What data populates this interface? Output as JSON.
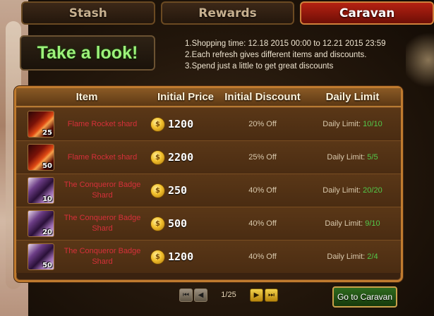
{
  "tabs": [
    {
      "label": "Stash",
      "active": false
    },
    {
      "label": "Rewards",
      "active": false
    },
    {
      "label": "Caravan",
      "active": true
    }
  ],
  "banner": {
    "title": "Take a look!"
  },
  "rules": [
    "1.Shopping time: 12.18 2015 00:00 to 12.21 2015 23:59",
    "2.Each refresh gives different items and discounts.",
    "3.Spend just a little to get great discounts"
  ],
  "table": {
    "headers": [
      "Item",
      "Initial Price",
      "Initial Discount",
      "Daily Limit"
    ],
    "rows": [
      {
        "icon": "flame-rocket-shard-icon",
        "qty": "25",
        "name": "Flame Rocket shard",
        "price": "1200",
        "discount": "20% Off",
        "limit_label": "Daily Limit:",
        "limit_value": "10/10"
      },
      {
        "icon": "flame-rocket-shard-icon",
        "qty": "50",
        "name": "Flame Rocket shard",
        "price": "2200",
        "discount": "25% Off",
        "limit_label": "Daily Limit:",
        "limit_value": "5/5"
      },
      {
        "icon": "conqueror-badge-shard-icon",
        "qty": "10",
        "name": "The Conqueror Badge Shard",
        "price": "250",
        "discount": "40% Off",
        "limit_label": "Daily Limit:",
        "limit_value": "20/20"
      },
      {
        "icon": "conqueror-badge-shard-icon",
        "qty": "20",
        "name": "The Conqueror Badge Shard",
        "price": "500",
        "discount": "40% Off",
        "limit_label": "Daily Limit:",
        "limit_value": "9/10"
      },
      {
        "icon": "conqueror-badge-shard-icon",
        "qty": "50",
        "name": "The Conqueror Badge Shard",
        "price": "1200",
        "discount": "40% Off",
        "limit_label": "Daily Limit:",
        "limit_value": "2/4"
      }
    ]
  },
  "pager": {
    "first_icon": "first-page-icon",
    "prev_icon": "prev-page-icon",
    "next_icon": "next-page-icon",
    "last_icon": "last-page-icon",
    "info": "1/25"
  },
  "go_button": {
    "label": "Go to Caravan"
  },
  "colors": {
    "accent_red": "#b52212",
    "item_name_red": "#d6303a",
    "limit_green": "#52c94a",
    "take_look_green": "#9cf27a",
    "panel_border": "#c07b2f"
  }
}
